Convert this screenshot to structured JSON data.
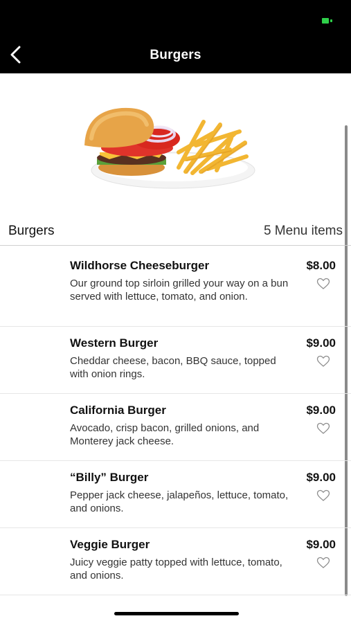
{
  "navbar": {
    "title": "Burgers",
    "back_icon": "chevron-left-icon"
  },
  "hero": {
    "image": "burger-and-fries-photo"
  },
  "section": {
    "title": "Burgers",
    "count_label": "5 Menu items"
  },
  "items": [
    {
      "name": "Wildhorse Cheeseburger",
      "price": "$8.00",
      "description": "Our ground top sirloin grilled your way on a bun served with lettuce, tomato, and onion."
    },
    {
      "name": "Western Burger",
      "price": "$9.00",
      "description": "Cheddar cheese, bacon, BBQ sauce, topped with onion rings."
    },
    {
      "name": "California Burger",
      "price": "$9.00",
      "description": "Avocado, crisp bacon, grilled onions, and Monterey jack cheese."
    },
    {
      "name": "“Billy” Burger",
      "price": "$9.00",
      "description": "Pepper jack cheese, jalapeños, lettuce, tomato, and onions."
    },
    {
      "name": "Veggie Burger",
      "price": "$9.00",
      "description": "Juicy veggie patty topped with lettuce, tomato, and onions."
    }
  ],
  "colors": {
    "header_bg": "#000000",
    "battery": "#2fd04a",
    "divider": "#e6e6e6"
  }
}
